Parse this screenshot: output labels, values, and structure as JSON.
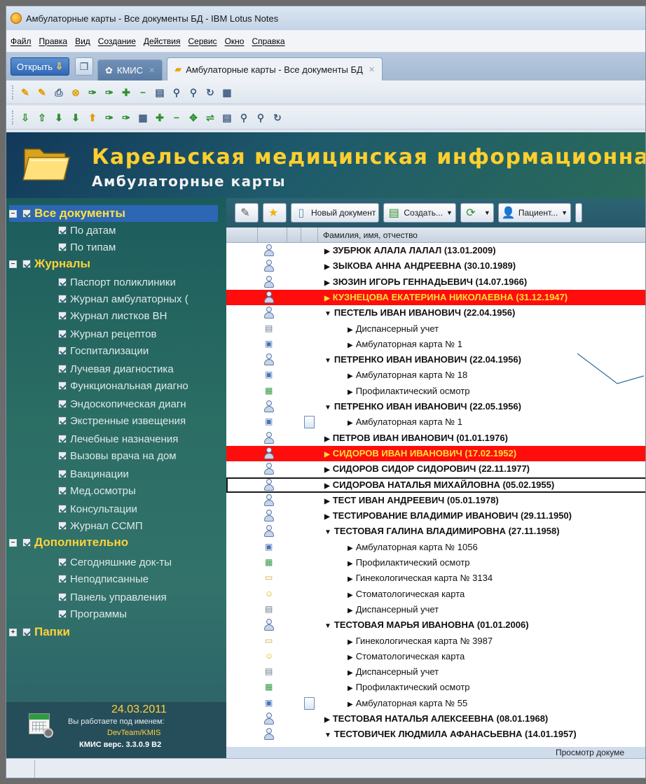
{
  "window": {
    "title": "Амбулаторные карты - Все документы БД - IBM Lotus Notes"
  },
  "menu": [
    "Файл",
    "Правка",
    "Вид",
    "Создание",
    "Действия",
    "Сервис",
    "Окно",
    "Справка"
  ],
  "tabs": {
    "open_label": "Открыть",
    "items": [
      {
        "label": "КМИС",
        "active": false
      },
      {
        "label": "Амбулаторные карты - Все документы БД",
        "active": true
      }
    ]
  },
  "banner": {
    "title": "Карельская медицинская информационная с",
    "subtitle": "Амбулаторные карты"
  },
  "nav": {
    "items": [
      {
        "label": "Все документы",
        "type": "section",
        "expander": "−",
        "selected": true
      },
      {
        "label": "По датам",
        "type": "item"
      },
      {
        "label": "По типам",
        "type": "item"
      },
      {
        "label": "Журналы",
        "type": "section",
        "expander": "−"
      },
      {
        "label": "Паспорт поликлиники",
        "type": "item"
      },
      {
        "label": "Журнал амбулаторных (",
        "type": "item"
      },
      {
        "label": "Журнал листков ВН",
        "type": "item"
      },
      {
        "label": "Журнал рецептов",
        "type": "item"
      },
      {
        "label": "Госпитализации",
        "type": "item"
      },
      {
        "label": "Лучевая диагностика",
        "type": "item"
      },
      {
        "label": "Функциональная диагно",
        "type": "item"
      },
      {
        "label": "Эндоскопическая диагн",
        "type": "item"
      },
      {
        "label": "Экстренные извещения",
        "type": "item"
      },
      {
        "label": "Лечебные назначения",
        "type": "item"
      },
      {
        "label": "Вызовы врача на дом",
        "type": "item"
      },
      {
        "label": "Вакцинации",
        "type": "item"
      },
      {
        "label": "Мед.осмотры",
        "type": "item"
      },
      {
        "label": "Консультации",
        "type": "item"
      },
      {
        "label": "Журнал ССМП",
        "type": "item"
      },
      {
        "label": "Дополнительно",
        "type": "section",
        "expander": "−"
      },
      {
        "label": "Сегодняшние док-ты",
        "type": "item"
      },
      {
        "label": "Неподписанные",
        "type": "item"
      },
      {
        "label": "Панель управления",
        "type": "item"
      },
      {
        "label": "Программы",
        "type": "item"
      },
      {
        "label": "Папки",
        "type": "section",
        "expander": "+"
      }
    ],
    "footer": {
      "date": "24.03.2011",
      "user_label": "Вы работаете под именем:",
      "user": "DevTeam/KMIS",
      "version": "КМИС верс. 3.3.0.9 В2"
    }
  },
  "actions": {
    "new_doc": "Новый документ",
    "create": "Создать...",
    "patient": "Пациент..."
  },
  "view": {
    "column_header": "Фамилия, имя, отчество",
    "status_text": "Просмотр докуме",
    "rows": [
      {
        "text": "ЗУБРЮК АЛАЛА ЛАЛАЛ (13.01.2009)",
        "level": 0,
        "tri": "▶",
        "icon": "person"
      },
      {
        "text": "ЗЫКОВА АННА АНДРЕЕВНА (30.10.1989)",
        "level": 0,
        "tri": "▶",
        "icon": "person"
      },
      {
        "text": "ЗЮЗИН ИГОРЬ ГЕННАДЬЕВИЧ (14.07.1966)",
        "level": 0,
        "tri": "▶",
        "icon": "person"
      },
      {
        "text": "КУЗНЕЦОВА ЕКАТЕРИНА НИКОЛАЕВНА (31.12.1947)",
        "level": 0,
        "tri": "▶",
        "icon": "person",
        "highlight": true
      },
      {
        "text": "ПЕСТЕЛЬ ИВАН ИВАНОВИЧ (22.04.1956)",
        "level": 0,
        "tri": "▼",
        "icon": "person"
      },
      {
        "text": "Диспансерный учет",
        "level": 1,
        "tri": "▶",
        "icon": "disp"
      },
      {
        "text": "Амбулаторная карта № 1",
        "level": 1,
        "tri": "▶",
        "icon": "card"
      },
      {
        "text": "ПЕТРЕНКО ИВАН ИВАНОВИЧ (22.04.1956)",
        "level": 0,
        "tri": "▼",
        "icon": "person"
      },
      {
        "text": "Амбулаторная карта № 18",
        "level": 1,
        "tri": "▶",
        "icon": "card"
      },
      {
        "text": "Профилактический осмотр",
        "level": 1,
        "tri": "▶",
        "icon": "grid"
      },
      {
        "text": "ПЕТРЕНКО ИВАН ИВАНОВИЧ (22.05.1956)",
        "level": 0,
        "tri": "▼",
        "icon": "person"
      },
      {
        "text": "Амбулаторная карта № 1",
        "level": 1,
        "tri": "▶",
        "icon": "card",
        "doc": true
      },
      {
        "text": "ПЕТРОВ ИВАН ИВАНОВИЧ (01.01.1976)",
        "level": 0,
        "tri": "▶",
        "icon": "person"
      },
      {
        "text": "СИДОРОВ ИВАН ИВАНОВИЧ (17.02.1952)",
        "level": 0,
        "tri": "▶",
        "icon": "person",
        "highlight": true
      },
      {
        "text": "СИДОРОВ СИДОР СИДОРОВИЧ (22.11.1977)",
        "level": 0,
        "tri": "▶",
        "icon": "person"
      },
      {
        "text": "СИДОРОВА НАТАЛЬЯ МИХАЙЛОВНА (05.02.1955)",
        "level": 0,
        "tri": "▶",
        "icon": "person",
        "boxed": true
      },
      {
        "text": "ТЕСТ ИВАН АНДРЕЕВИЧ (05.01.1978)",
        "level": 0,
        "tri": "▶",
        "icon": "person"
      },
      {
        "text": "ТЕСТИРОВАНИЕ ВЛАДИМИР ИВАНОВИЧ (29.11.1950)",
        "level": 0,
        "tri": "▶",
        "icon": "person"
      },
      {
        "text": "ТЕСТОВАЯ ГАЛИНА ВЛАДИМИРОВНА (27.11.1958)",
        "level": 0,
        "tri": "▼",
        "icon": "person"
      },
      {
        "text": "Амбулаторная карта № 1056",
        "level": 1,
        "tri": "▶",
        "icon": "card"
      },
      {
        "text": "Профилактический осмотр",
        "level": 1,
        "tri": "▶",
        "icon": "grid"
      },
      {
        "text": "Гинекологическая карта №  3134",
        "level": 1,
        "tri": "▶",
        "icon": "gyn"
      },
      {
        "text": "Стоматологическая карта",
        "level": 1,
        "tri": "▶",
        "icon": "stom"
      },
      {
        "text": "Диспансерный учет",
        "level": 1,
        "tri": "▶",
        "icon": "disp"
      },
      {
        "text": "ТЕСТОВАЯ МАРЬЯ ИВАНОВНА (01.01.2006)",
        "level": 0,
        "tri": "▼",
        "icon": "person"
      },
      {
        "text": "Гинекологическая карта № 3987",
        "level": 1,
        "tri": "▶",
        "icon": "gyn"
      },
      {
        "text": "Стоматологическая карта",
        "level": 1,
        "tri": "▶",
        "icon": "stom"
      },
      {
        "text": "Диспансерный учет",
        "level": 1,
        "tri": "▶",
        "icon": "disp"
      },
      {
        "text": "Профилактический осмотр",
        "level": 1,
        "tri": "▶",
        "icon": "grid"
      },
      {
        "text": "Амбулаторная карта № 55",
        "level": 1,
        "tri": "▶",
        "icon": "card",
        "doc": true
      },
      {
        "text": "ТЕСТОВАЯ НАТАЛЬЯ АЛЕКСЕЕВНА (08.01.1968)",
        "level": 0,
        "tri": "▶",
        "icon": "person"
      },
      {
        "text": "ТЕСТОВИЧЕК ЛЮДМИЛА АФАНАСЬЕВНА (14.01.1957)",
        "level": 0,
        "tri": "▼",
        "icon": "person"
      }
    ]
  },
  "colors": {
    "highlight_row": "#ff0d0d",
    "highlight_text": "#ffe23a",
    "nav_section": "#ffd23a",
    "banner_title": "#ffcf2e"
  }
}
